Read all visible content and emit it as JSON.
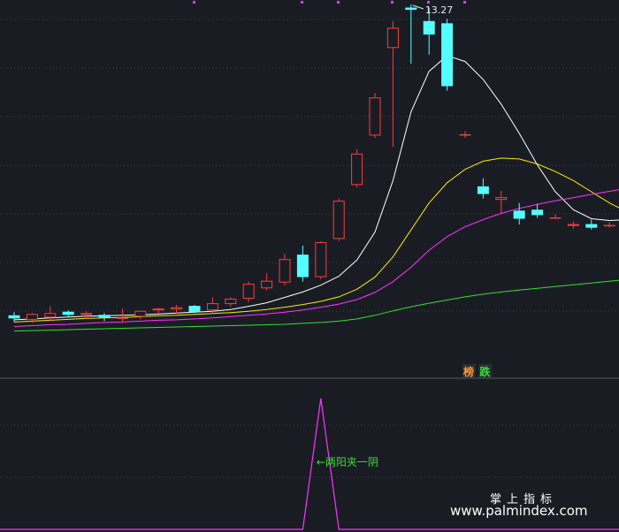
{
  "chart_data": [
    {
      "type": "candlestick",
      "panel": "price",
      "max_price_label": "13.27",
      "x": [
        0,
        1,
        2,
        3,
        4,
        5,
        6,
        7,
        8,
        9,
        10,
        11,
        12,
        13,
        14,
        15,
        16,
        17,
        18,
        19,
        20,
        21,
        22,
        23,
        24,
        25,
        26,
        27,
        28,
        29,
        30,
        31,
        32,
        33,
        34
      ],
      "candles": [
        {
          "o": 6.35,
          "h": 6.42,
          "l": 6.2,
          "c": 6.28
        },
        {
          "o": 6.25,
          "h": 6.4,
          "l": 6.18,
          "c": 6.38
        },
        {
          "o": 6.3,
          "h": 6.55,
          "l": 6.22,
          "c": 6.4
        },
        {
          "o": 6.43,
          "h": 6.46,
          "l": 6.3,
          "c": 6.36
        },
        {
          "o": 6.36,
          "h": 6.44,
          "l": 6.28,
          "c": 6.4
        },
        {
          "o": 6.36,
          "h": 6.4,
          "l": 6.22,
          "c": 6.3
        },
        {
          "o": 6.3,
          "h": 6.5,
          "l": 6.2,
          "c": 6.3
        },
        {
          "o": 6.32,
          "h": 6.46,
          "l": 6.26,
          "c": 6.45
        },
        {
          "o": 6.46,
          "h": 6.52,
          "l": 6.38,
          "c": 6.5
        },
        {
          "o": 6.48,
          "h": 6.58,
          "l": 6.38,
          "c": 6.53
        },
        {
          "o": 6.56,
          "h": 6.58,
          "l": 6.4,
          "c": 6.42
        },
        {
          "o": 6.46,
          "h": 6.75,
          "l": 6.4,
          "c": 6.62
        },
        {
          "o": 6.6,
          "h": 6.75,
          "l": 6.55,
          "c": 6.72
        },
        {
          "o": 6.72,
          "h": 7.1,
          "l": 6.65,
          "c": 7.05
        },
        {
          "o": 6.95,
          "h": 7.28,
          "l": 6.9,
          "c": 7.12
        },
        {
          "o": 7.08,
          "h": 7.72,
          "l": 7.02,
          "c": 7.6
        },
        {
          "o": 7.7,
          "h": 7.9,
          "l": 7.1,
          "c": 7.2
        },
        {
          "o": 7.2,
          "h": 8.0,
          "l": 7.15,
          "c": 7.98
        },
        {
          "o": 8.05,
          "h": 8.95,
          "l": 8.0,
          "c": 8.9
        },
        {
          "o": 9.25,
          "h": 10.05,
          "l": 9.2,
          "c": 9.95
        },
        {
          "o": 10.35,
          "h": 11.3,
          "l": 10.3,
          "c": 11.2
        },
        {
          "o": 12.3,
          "h": 12.9,
          "l": 10.1,
          "c": 12.75
        },
        {
          "o": 13.2,
          "h": 13.27,
          "l": 11.95,
          "c": 13.15
        },
        {
          "o": 12.9,
          "h": 13.2,
          "l": 12.15,
          "c": 12.6
        },
        {
          "o": 12.85,
          "h": 12.95,
          "l": 11.35,
          "c": 11.45
        },
        {
          "o": 10.38,
          "h": 10.45,
          "l": 10.3,
          "c": 10.38
        },
        {
          "o": 9.22,
          "h": 9.4,
          "l": 8.95,
          "c": 9.05
        },
        {
          "o": 8.92,
          "h": 9.12,
          "l": 8.6,
          "c": 8.98
        },
        {
          "o": 8.68,
          "h": 8.85,
          "l": 8.37,
          "c": 8.5
        },
        {
          "o": 8.7,
          "h": 8.83,
          "l": 8.52,
          "c": 8.58
        },
        {
          "o": 8.53,
          "h": 8.6,
          "l": 8.5,
          "c": 8.53
        },
        {
          "o": 8.34,
          "h": 8.44,
          "l": 8.28,
          "c": 8.38
        },
        {
          "o": 8.38,
          "h": 8.48,
          "l": 8.26,
          "c": 8.3
        },
        {
          "o": 8.36,
          "h": 8.42,
          "l": 8.3,
          "c": 8.36
        },
        {
          "o": 8.38,
          "h": 8.46,
          "l": 8.32,
          "c": 8.44
        }
      ],
      "moving_averages": [
        {
          "color": "#ffffff",
          "values": [
            6.25,
            6.27,
            6.29,
            6.31,
            6.33,
            6.34,
            6.35,
            6.36,
            6.38,
            6.4,
            6.42,
            6.44,
            6.48,
            6.55,
            6.63,
            6.75,
            6.87,
            7.02,
            7.22,
            7.58,
            8.2,
            9.35,
            10.88,
            11.78,
            12.13,
            12.0,
            11.6,
            11.05,
            10.4,
            9.7,
            9.1,
            8.7,
            8.5,
            8.46,
            8.48
          ]
        },
        {
          "color": "#ffea00",
          "values": [
            6.2,
            6.22,
            6.24,
            6.26,
            6.28,
            6.29,
            6.3,
            6.32,
            6.34,
            6.35,
            6.37,
            6.39,
            6.41,
            6.44,
            6.48,
            6.53,
            6.59,
            6.66,
            6.76,
            6.93,
            7.2,
            7.65,
            8.25,
            8.85,
            9.3,
            9.6,
            9.78,
            9.85,
            9.83,
            9.72,
            9.55,
            9.35,
            9.1,
            8.85,
            8.65
          ]
        },
        {
          "color": "#ff33ff",
          "values": [
            6.1,
            6.12,
            6.14,
            6.15,
            6.17,
            6.19,
            6.2,
            6.22,
            6.24,
            6.25,
            6.27,
            6.29,
            6.32,
            6.35,
            6.38,
            6.42,
            6.47,
            6.53,
            6.6,
            6.7,
            6.86,
            7.1,
            7.42,
            7.8,
            8.1,
            8.32,
            8.48,
            8.62,
            8.73,
            8.82,
            8.9,
            8.97,
            9.04,
            9.11,
            9.18
          ]
        },
        {
          "color": "#33e033",
          "values": [
            6.0,
            6.01,
            6.02,
            6.03,
            6.04,
            6.05,
            6.06,
            6.07,
            6.08,
            6.09,
            6.1,
            6.11,
            6.12,
            6.13,
            6.14,
            6.15,
            6.17,
            6.19,
            6.22,
            6.27,
            6.35,
            6.45,
            6.54,
            6.62,
            6.69,
            6.76,
            6.82,
            6.87,
            6.91,
            6.95,
            6.99,
            7.03,
            7.07,
            7.11,
            7.15
          ]
        }
      ],
      "tags": [
        {
          "text": "榜",
          "x": 24.9,
          "color": "#ff9933"
        },
        {
          "text": "跌",
          "x": 25.8,
          "color": "#33e033"
        }
      ]
    },
    {
      "type": "line",
      "panel": "indicator",
      "color": "#ff33ff",
      "signal_values": [
        0,
        0,
        0,
        0,
        0,
        0,
        0,
        0,
        0,
        0,
        0,
        0,
        0,
        0,
        0,
        0,
        0,
        1,
        0,
        0,
        0,
        0,
        0,
        0,
        0,
        0,
        0,
        0,
        0,
        0,
        0,
        0,
        0,
        0,
        0
      ],
      "annotation": "←两阳夹一阴"
    }
  ],
  "watermark": {
    "line1": "掌上指标",
    "line2": "www.palmindex.com"
  }
}
